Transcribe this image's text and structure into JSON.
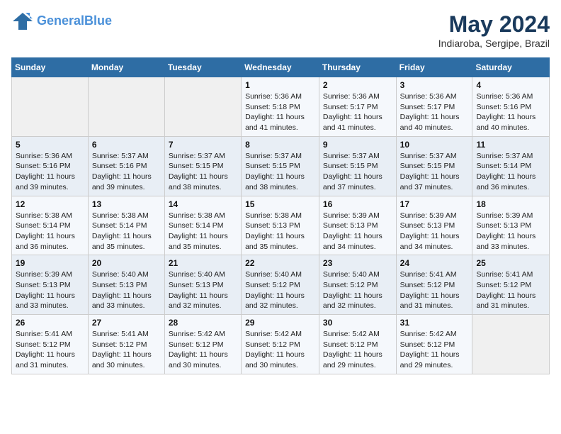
{
  "header": {
    "logo_line1": "General",
    "logo_line2": "Blue",
    "month_title": "May 2024",
    "location": "Indiaroba, Sergipe, Brazil"
  },
  "days_of_week": [
    "Sunday",
    "Monday",
    "Tuesday",
    "Wednesday",
    "Thursday",
    "Friday",
    "Saturday"
  ],
  "weeks": [
    [
      {
        "day": "",
        "info": ""
      },
      {
        "day": "",
        "info": ""
      },
      {
        "day": "",
        "info": ""
      },
      {
        "day": "1",
        "info": "Sunrise: 5:36 AM\nSunset: 5:18 PM\nDaylight: 11 hours\nand 41 minutes."
      },
      {
        "day": "2",
        "info": "Sunrise: 5:36 AM\nSunset: 5:17 PM\nDaylight: 11 hours\nand 41 minutes."
      },
      {
        "day": "3",
        "info": "Sunrise: 5:36 AM\nSunset: 5:17 PM\nDaylight: 11 hours\nand 40 minutes."
      },
      {
        "day": "4",
        "info": "Sunrise: 5:36 AM\nSunset: 5:16 PM\nDaylight: 11 hours\nand 40 minutes."
      }
    ],
    [
      {
        "day": "5",
        "info": "Sunrise: 5:36 AM\nSunset: 5:16 PM\nDaylight: 11 hours\nand 39 minutes."
      },
      {
        "day": "6",
        "info": "Sunrise: 5:37 AM\nSunset: 5:16 PM\nDaylight: 11 hours\nand 39 minutes."
      },
      {
        "day": "7",
        "info": "Sunrise: 5:37 AM\nSunset: 5:15 PM\nDaylight: 11 hours\nand 38 minutes."
      },
      {
        "day": "8",
        "info": "Sunrise: 5:37 AM\nSunset: 5:15 PM\nDaylight: 11 hours\nand 38 minutes."
      },
      {
        "day": "9",
        "info": "Sunrise: 5:37 AM\nSunset: 5:15 PM\nDaylight: 11 hours\nand 37 minutes."
      },
      {
        "day": "10",
        "info": "Sunrise: 5:37 AM\nSunset: 5:15 PM\nDaylight: 11 hours\nand 37 minutes."
      },
      {
        "day": "11",
        "info": "Sunrise: 5:37 AM\nSunset: 5:14 PM\nDaylight: 11 hours\nand 36 minutes."
      }
    ],
    [
      {
        "day": "12",
        "info": "Sunrise: 5:38 AM\nSunset: 5:14 PM\nDaylight: 11 hours\nand 36 minutes."
      },
      {
        "day": "13",
        "info": "Sunrise: 5:38 AM\nSunset: 5:14 PM\nDaylight: 11 hours\nand 35 minutes."
      },
      {
        "day": "14",
        "info": "Sunrise: 5:38 AM\nSunset: 5:14 PM\nDaylight: 11 hours\nand 35 minutes."
      },
      {
        "day": "15",
        "info": "Sunrise: 5:38 AM\nSunset: 5:13 PM\nDaylight: 11 hours\nand 35 minutes."
      },
      {
        "day": "16",
        "info": "Sunrise: 5:39 AM\nSunset: 5:13 PM\nDaylight: 11 hours\nand 34 minutes."
      },
      {
        "day": "17",
        "info": "Sunrise: 5:39 AM\nSunset: 5:13 PM\nDaylight: 11 hours\nand 34 minutes."
      },
      {
        "day": "18",
        "info": "Sunrise: 5:39 AM\nSunset: 5:13 PM\nDaylight: 11 hours\nand 33 minutes."
      }
    ],
    [
      {
        "day": "19",
        "info": "Sunrise: 5:39 AM\nSunset: 5:13 PM\nDaylight: 11 hours\nand 33 minutes."
      },
      {
        "day": "20",
        "info": "Sunrise: 5:40 AM\nSunset: 5:13 PM\nDaylight: 11 hours\nand 33 minutes."
      },
      {
        "day": "21",
        "info": "Sunrise: 5:40 AM\nSunset: 5:13 PM\nDaylight: 11 hours\nand 32 minutes."
      },
      {
        "day": "22",
        "info": "Sunrise: 5:40 AM\nSunset: 5:12 PM\nDaylight: 11 hours\nand 32 minutes."
      },
      {
        "day": "23",
        "info": "Sunrise: 5:40 AM\nSunset: 5:12 PM\nDaylight: 11 hours\nand 32 minutes."
      },
      {
        "day": "24",
        "info": "Sunrise: 5:41 AM\nSunset: 5:12 PM\nDaylight: 11 hours\nand 31 minutes."
      },
      {
        "day": "25",
        "info": "Sunrise: 5:41 AM\nSunset: 5:12 PM\nDaylight: 11 hours\nand 31 minutes."
      }
    ],
    [
      {
        "day": "26",
        "info": "Sunrise: 5:41 AM\nSunset: 5:12 PM\nDaylight: 11 hours\nand 31 minutes."
      },
      {
        "day": "27",
        "info": "Sunrise: 5:41 AM\nSunset: 5:12 PM\nDaylight: 11 hours\nand 30 minutes."
      },
      {
        "day": "28",
        "info": "Sunrise: 5:42 AM\nSunset: 5:12 PM\nDaylight: 11 hours\nand 30 minutes."
      },
      {
        "day": "29",
        "info": "Sunrise: 5:42 AM\nSunset: 5:12 PM\nDaylight: 11 hours\nand 30 minutes."
      },
      {
        "day": "30",
        "info": "Sunrise: 5:42 AM\nSunset: 5:12 PM\nDaylight: 11 hours\nand 29 minutes."
      },
      {
        "day": "31",
        "info": "Sunrise: 5:42 AM\nSunset: 5:12 PM\nDaylight: 11 hours\nand 29 minutes."
      },
      {
        "day": "",
        "info": ""
      }
    ]
  ]
}
